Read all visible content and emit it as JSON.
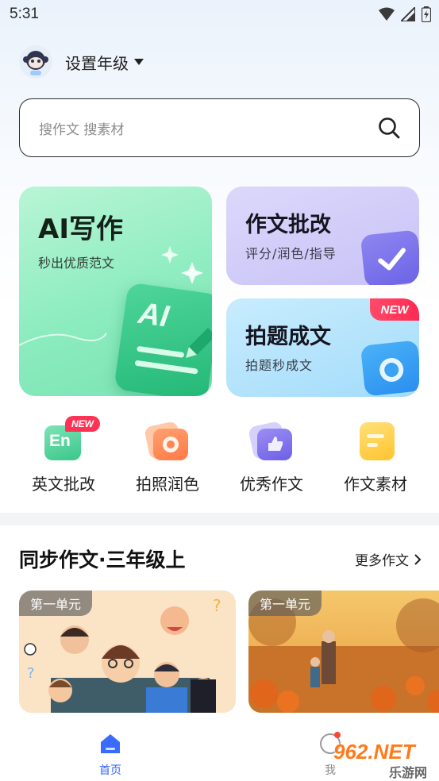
{
  "status_bar": {
    "time": "5:31"
  },
  "header": {
    "grade_label": "设置年级"
  },
  "search": {
    "placeholder": "搜作文 搜素材"
  },
  "cards": {
    "ai_writing": {
      "title": "AI写作",
      "subtitle": "秒出优质范文",
      "icon_text": "AI"
    },
    "essay_correction": {
      "title": "作文批改",
      "subtitle": "评分/润色/指导"
    },
    "photo_essay": {
      "title": "拍题成文",
      "subtitle": "拍题秒成文",
      "badge": "NEW"
    }
  },
  "tools": [
    {
      "label": "英文批改",
      "icon": "english-correction-icon",
      "icon_text": "En",
      "badge": "NEW"
    },
    {
      "label": "拍照润色",
      "icon": "camera-polish-icon"
    },
    {
      "label": "优秀作文",
      "icon": "thumbs-up-icon"
    },
    {
      "label": "作文素材",
      "icon": "material-icon"
    }
  ],
  "sync_section": {
    "title": "同步作文·三年级上",
    "more_label": "更多作文",
    "items": [
      {
        "tag": "第一单元"
      },
      {
        "tag": "第一单元"
      }
    ]
  },
  "bottom_nav": {
    "home_label": "首页",
    "mine_label": "我"
  },
  "watermark": {
    "text": "962.NET",
    "subtext": "乐游网"
  },
  "colors": {
    "accent": "#3366ff",
    "ai_card": "#8cecbf",
    "correction_card": "#c7c2f6",
    "photo_card": "#a3dcfb",
    "new_badge": "#ff3355"
  }
}
